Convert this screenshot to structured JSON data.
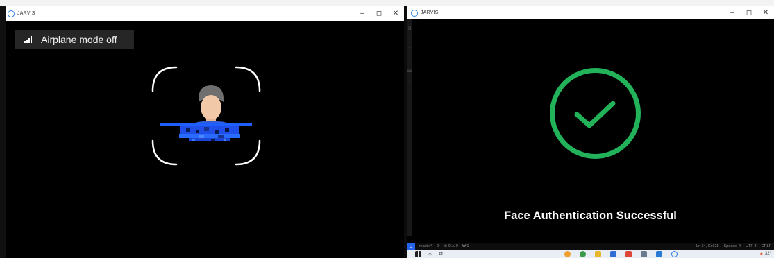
{
  "left_window": {
    "title": "JARVIS",
    "controls": {
      "minimize": "–",
      "maximize": "◻",
      "close": "✕"
    },
    "flyout": {
      "label": "Airplane mode off"
    }
  },
  "right_window": {
    "title": "JARVIS",
    "controls": {
      "minimize": "–",
      "maximize": "◻",
      "close": "✕"
    },
    "message": "Face Authentication Successful",
    "status_bar": {
      "branch": "master*",
      "sync": "⟳",
      "problems": "⊗ 0 ⚠ 0",
      "ports": "₩ 0",
      "cursor": "Ln 34, Col 28",
      "spaces": "Spaces: 4",
      "encoding": "UTF-8",
      "eol": "CRLF"
    },
    "taskbar": {
      "temperature": "32°"
    }
  },
  "colors": {
    "success_green": "#22b35a",
    "scan_blue": "#1f5fff",
    "titlebar_bg": "#ffffff",
    "flyout_bg": "#262626"
  }
}
